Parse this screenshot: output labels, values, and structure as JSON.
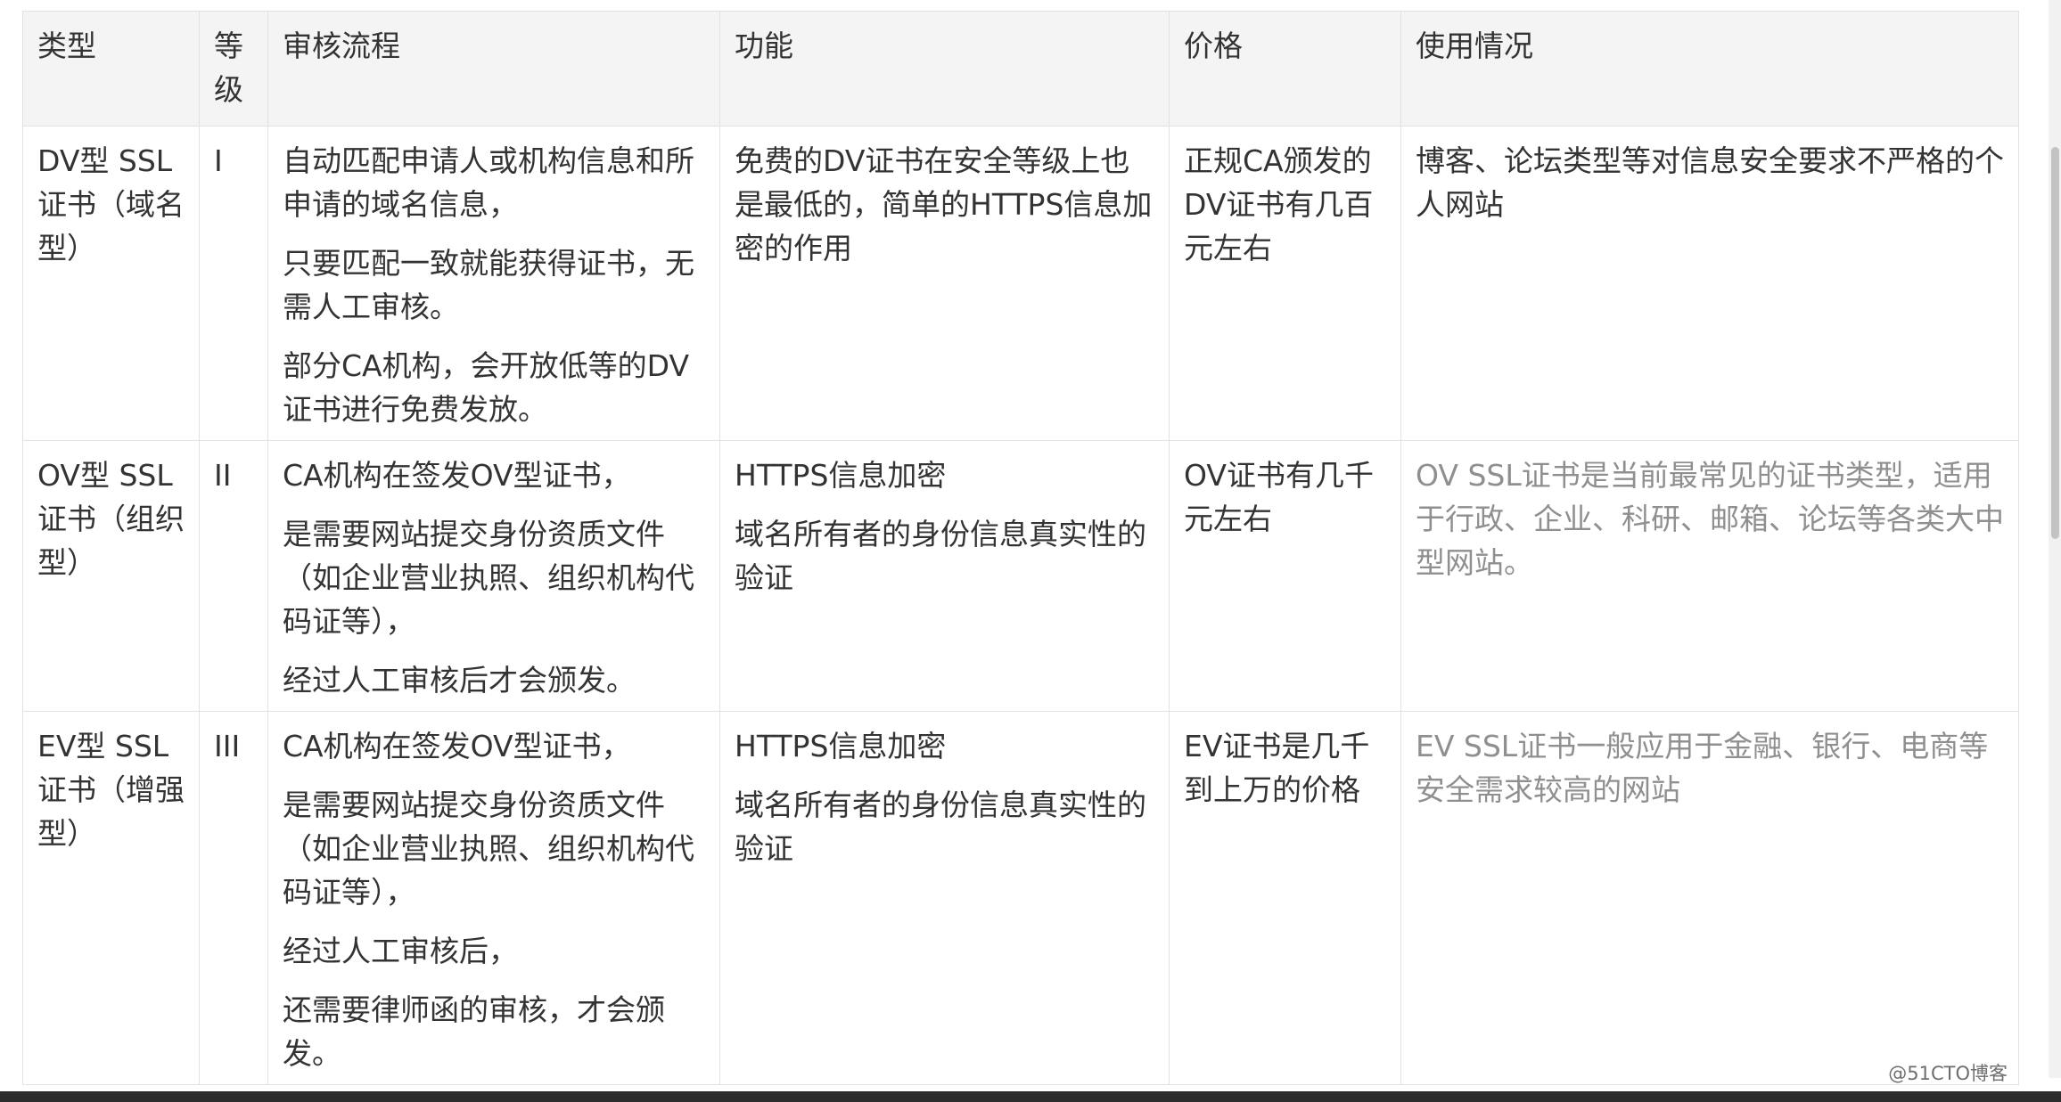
{
  "table": {
    "headers": [
      "类型",
      "等级",
      "审核流程",
      "功能",
      "价格",
      "使用情况"
    ],
    "rows": [
      {
        "type": "DV型 SSL证书（域名型）",
        "level": "I",
        "review": [
          "自动匹配申请人或机构信息和所申请的域名信息，",
          "只要匹配一致就能获得证书，无需人工审核。",
          "部分CA机构，会开放低等的DV证书进行免费发放。"
        ],
        "function": [
          "免费的DV证书在安全等级上也是最低的，简单的HTTPS信息加密的作用"
        ],
        "price": "正规CA颁发的DV证书有几百元左右",
        "usage": "博客、论坛类型等对信息安全要求不严格的个人网站"
      },
      {
        "type": "OV型 SSL证书（组织型）",
        "level": "II",
        "review": [
          "CA机构在签发OV型证书，",
          "是需要网站提交身份资质文件（如企业营业执照、组织机构代码证等），",
          "经过人工审核后才会颁发。"
        ],
        "function": [
          "HTTPS信息加密",
          "域名所有者的身份信息真实性的验证"
        ],
        "price": "OV证书有几千元左右",
        "usage": "OV SSL证书是当前最常见的证书类型，适用于行政、企业、科研、邮箱、论坛等各类大中型网站。"
      },
      {
        "type": "EV型 SSL证书（增强型）",
        "level": "III",
        "review": [
          "CA机构在签发OV型证书，",
          "是需要网站提交身份资质文件（如企业营业执照、组织机构代码证等），",
          "经过人工审核后，",
          "还需要律师函的审核，才会颁发。"
        ],
        "function": [
          "HTTPS信息加密",
          "域名所有者的身份信息真实性的验证"
        ],
        "price": "EV证书是几千到上万的价格",
        "usage": "EV SSL证书一般应用于金融、银行、电商等安全需求较高的网站"
      }
    ]
  },
  "watermark": "@51CTO博客",
  "colors": {
    "header_bg": "#f4f4f4",
    "border": "#e2e2e2",
    "text": "#333333",
    "muted_text": "#8f8f8f"
  }
}
